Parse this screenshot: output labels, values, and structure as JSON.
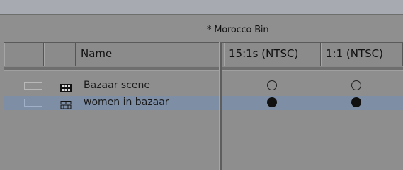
{
  "window": {
    "title": "* Morocco  Bin"
  },
  "columns": [
    {
      "label": ""
    },
    {
      "label": ""
    },
    {
      "label": "Name"
    },
    {
      "label": "15:1s (NTSC)"
    },
    {
      "label": "1:1 (NTSC)"
    }
  ],
  "rows": [
    {
      "name": "Bazaar scene",
      "icon": "sequence-icon",
      "col_15_1s": "empty",
      "col_1_1": "empty",
      "selected": false
    },
    {
      "name": "women in bazaar",
      "icon": "master-clip-icon",
      "col_15_1s": "filled",
      "col_1_1": "filled",
      "selected": true
    }
  ],
  "colors": {
    "selection": "#7d8ea5",
    "background": "#8e8e8e"
  }
}
